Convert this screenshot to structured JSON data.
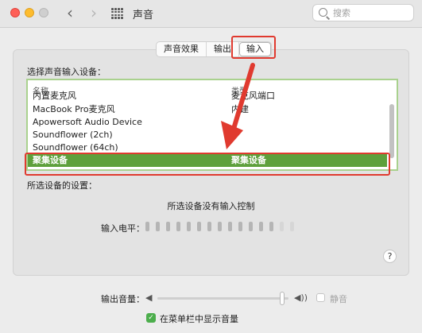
{
  "window": {
    "title": "声音"
  },
  "search": {
    "placeholder": "搜索"
  },
  "tabs": [
    {
      "label": "声音效果"
    },
    {
      "label": "输出"
    },
    {
      "label": "输入"
    }
  ],
  "input_section": {
    "label": "选择声音输入设备：",
    "columns": {
      "name": "名称",
      "type": "类型"
    },
    "partial_row": {
      "name": "内置麦克风",
      "type": "麦克风端口"
    },
    "rows": [
      {
        "name": "MacBook Pro麦克风",
        "type": "内建"
      },
      {
        "name": "Apowersoft Audio Device",
        "type": ""
      },
      {
        "name": "Soundflower (2ch)",
        "type": ""
      },
      {
        "name": "Soundflower (64ch)",
        "type": ""
      },
      {
        "name": "聚集设备",
        "type": "聚集设备"
      }
    ],
    "selected_index": 4
  },
  "settings": {
    "label": "所选设备的设置：",
    "no_controls": "所选设备没有输入控制",
    "level_label": "输入电平：",
    "level_bars_total": 15,
    "level_bars_dim_from": 13
  },
  "output": {
    "volume_label": "输出音量：",
    "volume_level": 0.95,
    "mute_label": "静音",
    "mute_checked": false,
    "show_in_menu_label": "在菜单栏中显示音量",
    "show_in_menu_checked": true
  },
  "icons": {
    "back": "chevron-left-icon",
    "forward": "chevron-right-icon",
    "grid": "grid-icon",
    "search": "search-icon",
    "help": "help-icon",
    "speaker_low": "speaker-low-icon",
    "speaker_high": "speaker-high-icon"
  },
  "colors": {
    "annotation": "#e03a2f",
    "selection": "#5ea03c",
    "table_highlight": "#a9d18e"
  }
}
